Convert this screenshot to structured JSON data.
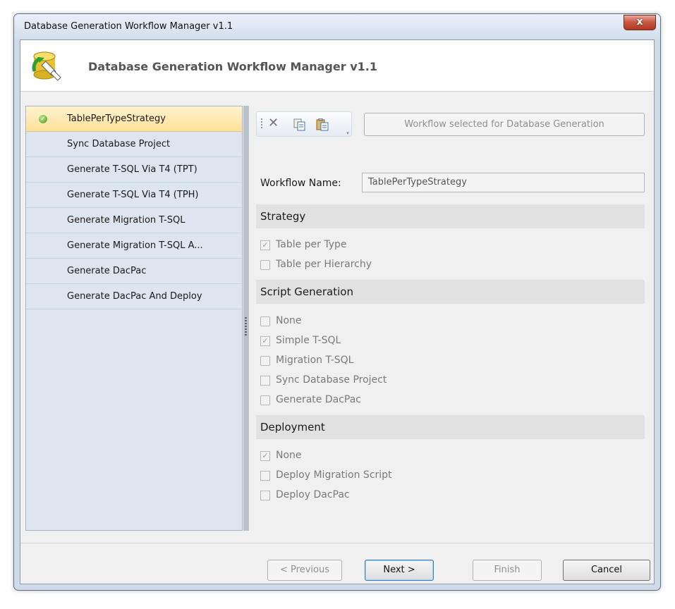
{
  "window": {
    "title": "Database Generation Workflow Manager v1.1",
    "close_glyph": "x"
  },
  "header": {
    "title": "Database Generation Workflow Manager v1.1"
  },
  "sidebar": {
    "items": [
      {
        "label": "TablePerTypeStrategy",
        "selected": true
      },
      {
        "label": "Sync Database Project"
      },
      {
        "label": "Generate T-SQL Via T4 (TPT)"
      },
      {
        "label": "Generate T-SQL Via T4 (TPH)"
      },
      {
        "label": "Generate Migration T-SQL"
      },
      {
        "label": "Generate Migration T-SQL A..."
      },
      {
        "label": "Generate DacPac"
      },
      {
        "label": "Generate DacPac And Deploy"
      }
    ]
  },
  "toolbar": {
    "icons": [
      "delete-icon",
      "copy-icon",
      "paste-icon"
    ],
    "workflow_selected_label": "Workflow selected for Database Generation"
  },
  "form": {
    "workflow_name_label": "Workflow Name:",
    "workflow_name_value": "TablePerTypeStrategy"
  },
  "strategy": {
    "title": "Strategy",
    "options": [
      {
        "label": "Table per Type",
        "checked": true
      },
      {
        "label": "Table per Hierarchy",
        "checked": false
      }
    ]
  },
  "script_generation": {
    "title": "Script Generation",
    "options": [
      {
        "label": "None",
        "checked": false
      },
      {
        "label": "Simple T-SQL",
        "checked": true
      },
      {
        "label": "Migration T-SQL",
        "checked": false
      },
      {
        "label": "Sync Database Project",
        "checked": false
      },
      {
        "label": "Generate DacPac",
        "checked": false
      }
    ]
  },
  "deployment": {
    "title": "Deployment",
    "options": [
      {
        "label": "None",
        "checked": true
      },
      {
        "label": "Deploy Migration Script",
        "checked": false
      },
      {
        "label": "Deploy DacPac",
        "checked": false
      }
    ]
  },
  "footer": {
    "previous_label": "< Previous",
    "next_label": "Next >",
    "finish_label": "Finish",
    "cancel_label": "Cancel"
  },
  "colors": {
    "selected_item": "#ffe09a",
    "accent_check": "#4f9d1f",
    "close_red": "#c85a45"
  }
}
